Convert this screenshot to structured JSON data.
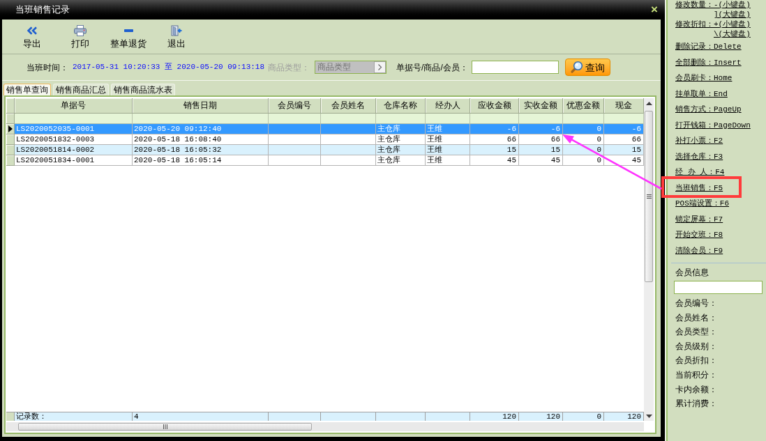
{
  "window": {
    "title": "当班销售记录",
    "close": "×"
  },
  "toolbar": [
    {
      "kind": "export",
      "label": "导出"
    },
    {
      "kind": "print",
      "label": "打印"
    },
    {
      "kind": "return",
      "label": "整单退货"
    },
    {
      "kind": "exit",
      "label": "退出"
    }
  ],
  "filters": {
    "shift_time_label": "当班时间：",
    "shift_time_range": "2017-05-31 10:20:33 至 2020-05-20 09:13:18",
    "category_label": "商品类型：",
    "category": {
      "value": "商品类型",
      "disabled": true
    },
    "search_label": "单据号/商品/会员：",
    "query_button": "查询"
  },
  "tabs": [
    {
      "label": "销售单查询",
      "selected": true
    },
    {
      "label": "销售商品汇总",
      "selected": false
    },
    {
      "label": "销售商品流水表",
      "selected": false
    }
  ],
  "table": {
    "columns": [
      {
        "label": "单据号",
        "kind": "text"
      },
      {
        "label": "销售日期",
        "kind": "text"
      },
      {
        "label": "会员编号",
        "kind": "text"
      },
      {
        "label": "会员姓名",
        "kind": "text"
      },
      {
        "label": "仓库名称",
        "kind": "text"
      },
      {
        "label": "经办人",
        "kind": "text"
      },
      {
        "label": "应收金额",
        "kind": "amount"
      },
      {
        "label": "实收金额",
        "kind": "amount"
      },
      {
        "label": "优惠金额",
        "kind": "amount"
      },
      {
        "label": "现金",
        "kind": "amount"
      }
    ],
    "rows": [
      {
        "selected": true,
        "cells": [
          "LS2020052035-0001",
          "2020-05-20 09:12:40",
          null,
          null,
          "主仓库",
          "王维",
          "-6",
          "-6",
          "0",
          "-6"
        ]
      },
      {
        "selected": false,
        "cells": [
          "LS2020051832-0003",
          "2020-05-18 16:08:40",
          null,
          null,
          "主仓库",
          "王维",
          "66",
          "66",
          "0",
          "66"
        ]
      },
      {
        "selected": false,
        "cells": [
          "LS2020051814-0002",
          "2020-05-18 16:05:32",
          null,
          null,
          "主仓库",
          "王维",
          "15",
          "15",
          "0",
          "15"
        ]
      },
      {
        "selected": false,
        "cells": [
          "LS2020051834-0001",
          "2020-05-18 16:05:14",
          null,
          null,
          "主仓库",
          "王维",
          "45",
          "45",
          "0",
          "45"
        ]
      }
    ],
    "summary": {
      "label": "记录数：",
      "count": "4",
      "amounts": [
        "120",
        "120",
        "0",
        "120"
      ]
    }
  },
  "shortcuts": [
    {
      "lines": [
        "修改数量：-(小键盘)",
        "](大键盘)"
      ],
      "highlighted": false
    },
    {
      "lines": [
        "修改折扣：+(小键盘)",
        "\\(大键盘)"
      ],
      "highlighted": false
    },
    {
      "lines": [
        "删除记录：Delete"
      ],
      "highlighted": false
    },
    {
      "lines": [
        "全部删除：Insert"
      ],
      "highlighted": false
    },
    {
      "lines": [
        "会员刷卡：Home"
      ],
      "highlighted": false
    },
    {
      "lines": [
        "挂单取单：End"
      ],
      "highlighted": false
    },
    {
      "lines": [
        "销售方式：PageUp"
      ],
      "highlighted": false
    },
    {
      "lines": [
        "打开钱箱：PageDown"
      ],
      "highlighted": false
    },
    {
      "lines": [
        "补打小票：F2"
      ],
      "highlighted": false
    },
    {
      "lines": [
        "选择仓库：F3"
      ],
      "highlighted": false
    },
    {
      "lines": [
        "经 办 人：F4"
      ],
      "highlighted": false
    },
    {
      "lines": [
        "当班销售：F5"
      ],
      "highlighted": true
    },
    {
      "lines": [
        "POS端设置：F6"
      ],
      "highlighted": false
    },
    {
      "lines": [
        "锁定屏幕：F7"
      ],
      "highlighted": false
    },
    {
      "lines": [
        "开始交班：F8"
      ],
      "highlighted": false
    },
    {
      "lines": [
        "清除会员：F9"
      ],
      "highlighted": false
    }
  ],
  "member_info": {
    "title": "会员信息",
    "fields": [
      "会员编号：",
      "会员姓名：",
      "会员类型：",
      "会员级别：",
      "会员折扣：",
      "当前积分：",
      "卡内余额：",
      "累计消费："
    ]
  },
  "pointer_arrow": true
}
